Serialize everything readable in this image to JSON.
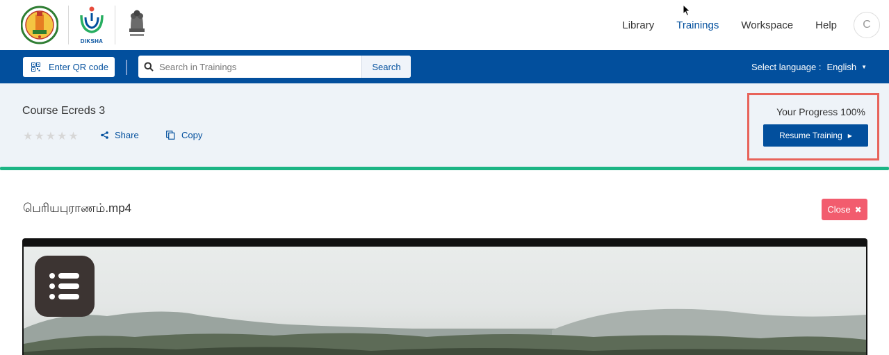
{
  "header": {
    "logos": {
      "tn_logo": "tamil-nadu-government-emblem",
      "diksha_logo_text": "DIKSHA",
      "india_emblem": "national-emblem-of-india"
    },
    "nav": [
      {
        "label": "Library",
        "active": false
      },
      {
        "label": "Trainings",
        "active": true
      },
      {
        "label": "Workspace",
        "active": false
      },
      {
        "label": "Help",
        "active": false
      }
    ],
    "avatar_initial": "C"
  },
  "toolbar": {
    "qr_label": "Enter QR code",
    "search_placeholder": "Search in Trainings",
    "search_button": "Search",
    "language_label": "Select language :",
    "language_value": "English"
  },
  "course": {
    "title": "Course Ecreds 3",
    "rating": 0,
    "rating_max": 5,
    "share_label": "Share",
    "copy_label": "Copy",
    "progress_text": "Your Progress 100%",
    "progress_value": 100,
    "resume_label": "Resume Training"
  },
  "content": {
    "title": "பெரியபுராணம்.mp4",
    "close_label": "Close"
  },
  "colors": {
    "primary": "#024f9d",
    "progress_line": "#1cb585",
    "close_button": "#f25c6e",
    "highlight_border": "#e8635a"
  }
}
